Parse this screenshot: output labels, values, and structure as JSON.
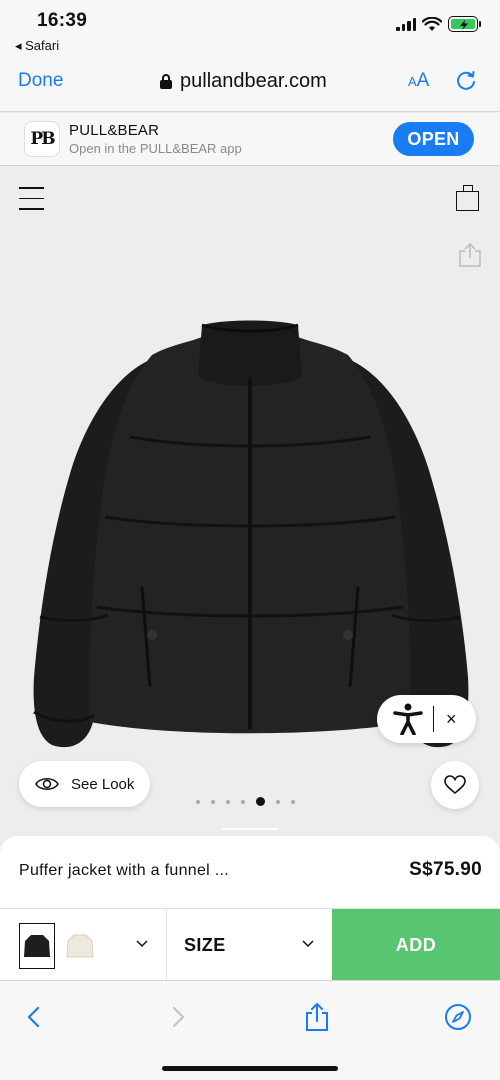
{
  "status_bar": {
    "time": "16:39",
    "back_app": "◂ Safari"
  },
  "browser": {
    "done_label": "Done",
    "url": "pullandbear.com",
    "text_size_small": "A",
    "text_size_large": "A"
  },
  "app_banner": {
    "logo_text": "PB",
    "name": "PULL&BEAR",
    "subtitle": "Open in the PULL&BEAR app",
    "open_label": "OPEN"
  },
  "gallery": {
    "see_look_label": "See Look",
    "dot_count": 7,
    "active_dot": 5,
    "close_glyph": "×"
  },
  "product": {
    "name": "Puffer jacket with a funnel ...",
    "price": "S$75.90"
  },
  "purchase": {
    "colors": [
      {
        "name": "black",
        "hex": "#1e1e1e"
      },
      {
        "name": "cream",
        "hex": "#efe8dc"
      }
    ],
    "size_label": "SIZE",
    "add_label": "ADD"
  },
  "colors": {
    "accent": "#1a7cf3",
    "add_button": "#58c671",
    "battery": "#34c759"
  },
  "icons": [
    "hamburger-icon",
    "bag-icon",
    "share-icon",
    "eye-icon",
    "heart-icon",
    "accessibility-icon",
    "close-icon",
    "chevron-down-icon",
    "back-icon",
    "forward-icon",
    "compass-icon",
    "reload-icon",
    "lock-icon"
  ]
}
